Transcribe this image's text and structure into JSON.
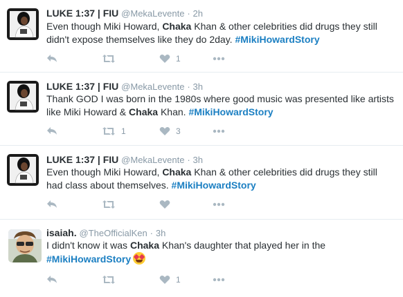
{
  "tweets": [
    {
      "name": "LUKE 1:37 | FIU",
      "handle": "@MekaLevente",
      "sep": "·",
      "time": "2h",
      "text_parts": [
        "Even though Miki Howard, ",
        "Chaka",
        " Khan & other celebrities did drugs they still didn't expose themselves like they do 2day.  ",
        "#MikiHowardStory"
      ],
      "retweet_count": "",
      "like_count": "1"
    },
    {
      "name": "LUKE 1:37 | FIU",
      "handle": "@MekaLevente",
      "sep": "·",
      "time": "3h",
      "text_parts": [
        "Thank GOD I was born in the 1980s where good music was presented like artists like Miki Howard & ",
        "Chaka",
        " Khan. ",
        "#MikiHowardStory"
      ],
      "retweet_count": "1",
      "like_count": "3"
    },
    {
      "name": "LUKE 1:37 | FIU",
      "handle": "@MekaLevente",
      "sep": "·",
      "time": "3h",
      "text_parts": [
        "Even though Miki Howard, ",
        "Chaka",
        " Khan & other celebrities did drugs they still had class about themselves.  ",
        "#MikiHowardStory"
      ],
      "retweet_count": "",
      "like_count": ""
    },
    {
      "name": "isaiah.",
      "handle": "@TheOfficialKen",
      "sep": "·",
      "time": "3h",
      "text_parts": [
        "I didn't know it was ",
        "Chaka",
        " Khan's daughter that played her in the ",
        "#MikiHowardStory"
      ],
      "emoji": "heart-eyes-emoji",
      "retweet_count": "",
      "like_count": "1"
    }
  ],
  "colors": {
    "hashtag": "#1b7fc2",
    "meta": "#8899a6",
    "icon": "#aab8c2",
    "divider": "#e6ecf0"
  },
  "icons": {
    "reply": "reply-icon",
    "retweet": "retweet-icon",
    "like": "heart-icon",
    "more": "more-icon"
  }
}
